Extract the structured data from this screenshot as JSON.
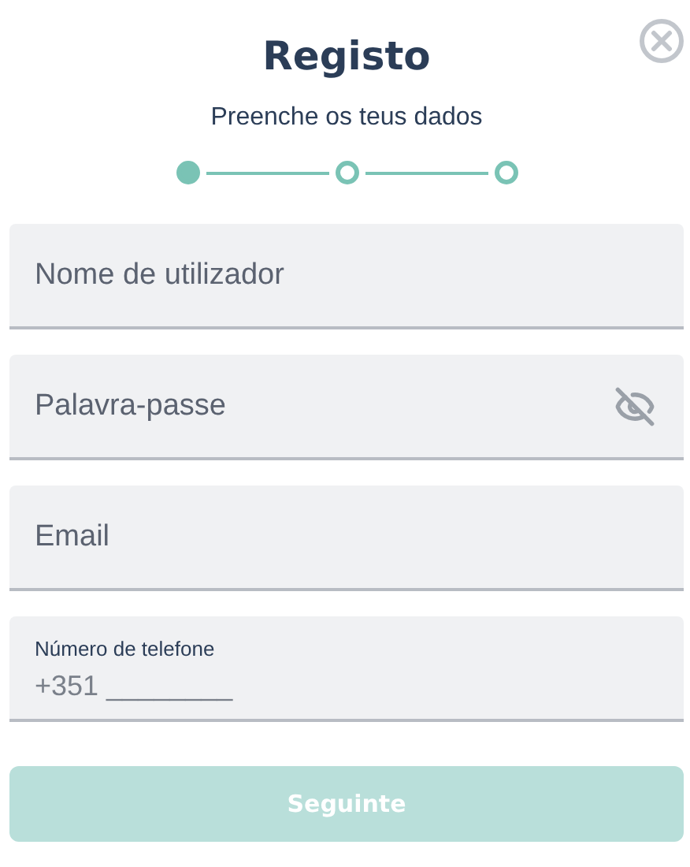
{
  "title": "Registo",
  "subtitle": "Preenche os teus dados",
  "steps": [
    {
      "selected": true
    },
    {
      "selected": false
    },
    {
      "selected": false
    }
  ],
  "fields": [
    {
      "kind": "text",
      "placeholder": "Nome de utilizador"
    },
    {
      "kind": "password",
      "placeholder": "Palavra-passe"
    },
    {
      "kind": "text",
      "placeholder": "Email"
    },
    {
      "kind": "labeled",
      "label": "Número de telefone",
      "placeholder": "+351 ________"
    }
  ],
  "button": {
    "label": "Seguinte",
    "disabled": true
  }
}
